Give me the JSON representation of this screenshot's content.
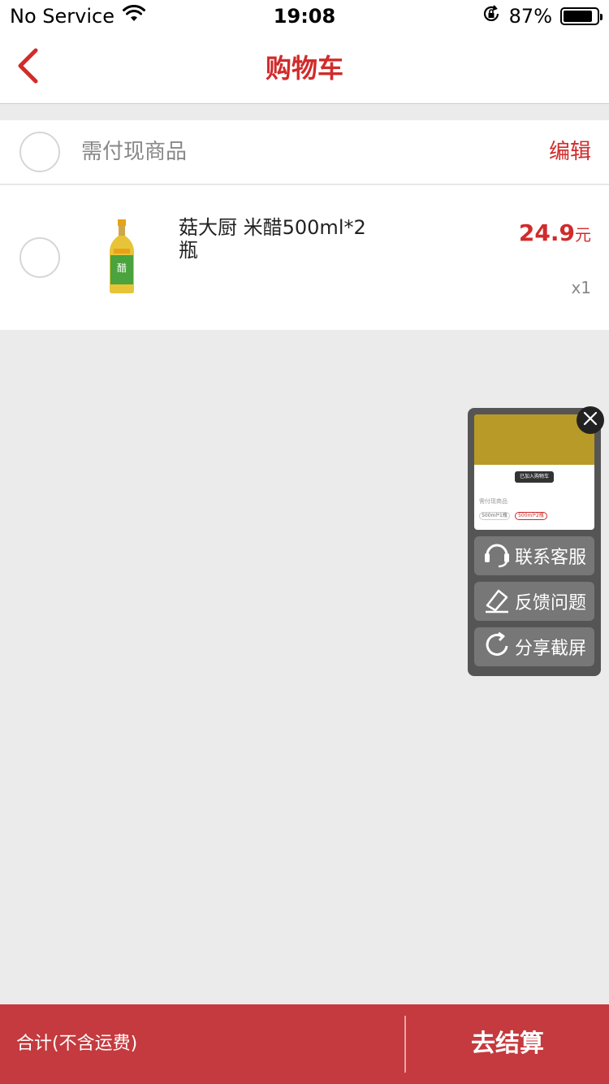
{
  "status_bar": {
    "carrier": "No Service",
    "time": "19:08",
    "battery_percent": "87%",
    "battery_level": 0.87
  },
  "nav": {
    "title": "购物车",
    "back_icon": "chevron-left-icon"
  },
  "cart": {
    "section_label": "需付现商品",
    "edit_label": "编辑",
    "items": [
      {
        "name": "菇大厨 米醋500ml*2瓶",
        "price": "24.9",
        "price_unit": "元",
        "quantity": "x1"
      }
    ]
  },
  "float_panel": {
    "preview": {
      "toast": "已加入购物车",
      "subtitle": "需付现商品",
      "tag1": "500ml*1瓶",
      "tag2": "500ml*2瓶"
    },
    "buttons": [
      {
        "label": "联系客服",
        "icon": "headset-icon"
      },
      {
        "label": "反馈问题",
        "icon": "feedback-icon"
      },
      {
        "label": "分享截屏",
        "icon": "share-icon"
      }
    ]
  },
  "bottom_bar": {
    "total_label": "合计(不含运费)",
    "checkout_label": "去结算"
  },
  "colors": {
    "accent": "#d12b2b",
    "bottom_bar": "#c43a3e",
    "background": "#ebebeb"
  }
}
